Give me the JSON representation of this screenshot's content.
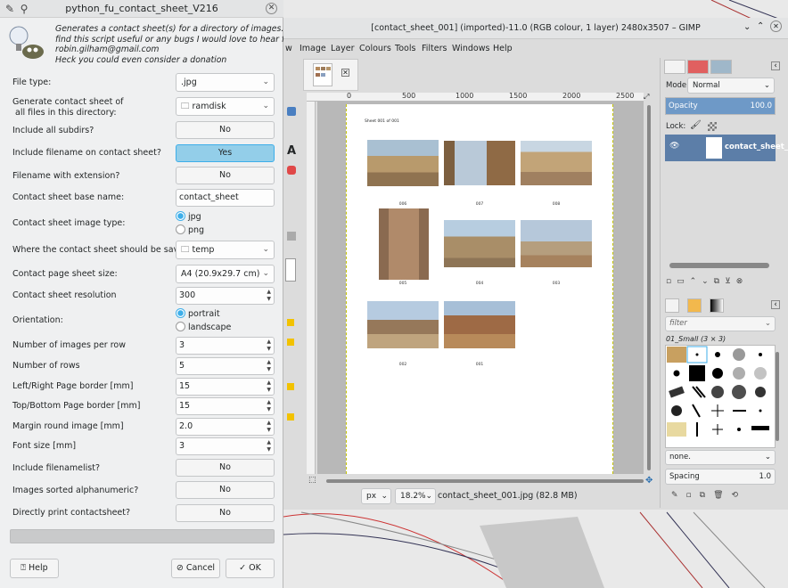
{
  "dialog": {
    "title": "python_fu_contact_sheet_V216",
    "intro_lines": [
      "Generates a contact sheet(s) for a directory of images. If you",
      "find this script useful or any bugs I would love to hear from you",
      "robin.gilham@gmail.com",
      "Heck you could even consider a donation"
    ],
    "fields": {
      "file_type": {
        "label": "File type:",
        "value": ".jpg"
      },
      "directory": {
        "label_line1": "Generate contact sheet of",
        "label_line2": " all files in this directory:",
        "value": "ramdisk"
      },
      "include_subdirs": {
        "label": "Include all subdirs?",
        "value": "No"
      },
      "include_filename": {
        "label": "Include filename on contact sheet?",
        "value": "Yes"
      },
      "filename_ext": {
        "label": "Filename with extension?",
        "value": "No"
      },
      "base_name": {
        "label": "Contact sheet base name:",
        "value": "contact_sheet"
      },
      "image_type": {
        "label": "Contact sheet image type:",
        "options": [
          "jpg",
          "png"
        ],
        "selected": "jpg"
      },
      "save_location": {
        "label": "Where the contact sheet should be saved in:",
        "value": "temp"
      },
      "page_size": {
        "label": "Contact page sheet size:",
        "value": "A4 (20.9x29.7 cm)"
      },
      "resolution": {
        "label": "Contact sheet resolution",
        "value": "300"
      },
      "orientation": {
        "label": "Orientation:",
        "options": [
          "portrait",
          "landscape"
        ],
        "selected": "portrait"
      },
      "images_per_row": {
        "label": "Number of images per row",
        "value": "3"
      },
      "rows": {
        "label": "Number of rows",
        "value": "5"
      },
      "lr_border": {
        "label": "Left/Right Page border [mm]",
        "value": "15"
      },
      "tb_border": {
        "label": "Top/Bottom Page border [mm]",
        "value": "15"
      },
      "margin": {
        "label": "Margin round image [mm]",
        "value": "2.0"
      },
      "font_size": {
        "label": "Font size [mm]",
        "value": "3"
      },
      "filenamelist": {
        "label": "Include filenamelist?",
        "value": "No"
      },
      "sorted": {
        "label": "Images sorted alphanumeric?",
        "value": "No"
      },
      "print": {
        "label": "Directly print contactsheet?",
        "value": "No"
      }
    },
    "buttons": {
      "help": "Help",
      "cancel": "Cancel",
      "ok": "OK"
    }
  },
  "gimp": {
    "title": "[contact_sheet_001] (imported)-11.0 (RGB colour, 1 layer) 2480x3507 – GIMP",
    "menu": [
      "w",
      "Image",
      "Layer",
      "Colours",
      "Tools",
      "Filters",
      "Windows",
      "Help"
    ],
    "ruler_marks": [
      "0",
      "500",
      "1000",
      "1500",
      "2000",
      "2500"
    ],
    "sheet_header": "Sheet 001 of 001",
    "captions": [
      "006",
      "007",
      "008",
      "005",
      "004",
      "003",
      "002",
      "001"
    ],
    "unit": "px",
    "zoom": "18.2%",
    "status": "contact_sheet_001.jpg (82.8 MB)",
    "layers": {
      "mode_label": "Mode:",
      "mode": "Normal",
      "opacity_label": "Opacity",
      "opacity": "100.0",
      "opacity_level": 1.0,
      "lock_label": "Lock:",
      "layer_name": "contact_sheet_"
    },
    "brushes": {
      "filter_placeholder": "filter",
      "brush_name": "01_Small (3 × 3)",
      "preset": "none.",
      "spacing_label": "Spacing",
      "spacing": "1.0"
    }
  },
  "colors": {
    "accent": "#3daee9",
    "toggle_on": "#93cee9",
    "opacity_bar": "#6e99c7",
    "layer_selected": "#5c7ea8"
  }
}
